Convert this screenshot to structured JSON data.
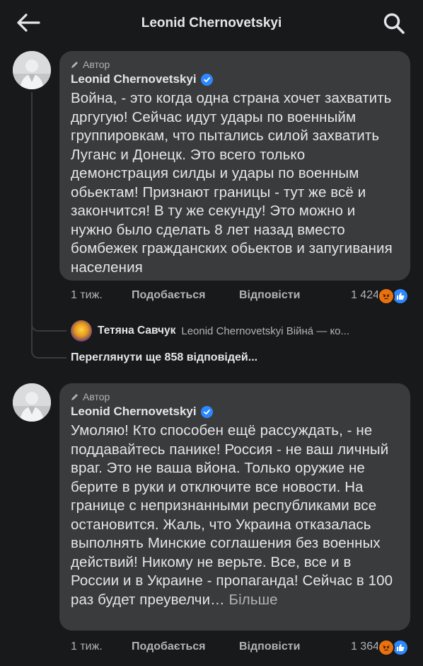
{
  "header": {
    "title": "Leonid Chernovetskyi",
    "back_icon": "arrow-left-icon",
    "search_icon": "search-icon"
  },
  "comments": [
    {
      "badge": "Автор",
      "author": "Leonid Chernovetskyi",
      "verified": true,
      "text": "Война, - это когда одна страна хочет захватить дргугую! Сейчас идут удары по военныйм группировкам, что пытались силой захватить Луганс и Донецк. Это всего только демонстрация силды и удары по военным обьектам!  Признают границы - тут же всё и  закончится! В ту же секунду! Это можно и нужно было сделать 8 лет назад вместо бомбежек гражданских обьектов и запугивания населения",
      "more": "",
      "time": "1 тиж.",
      "like_label": "Подобається",
      "reply_label": "Відповісти",
      "reaction_count": "1 424"
    },
    {
      "badge": "Автор",
      "author": "Leonid Chernovetskyi",
      "verified": true,
      "text": "Умоляю! Кто способен ещё рассуждать, - не поддавайтесь панике! Россия - не ваш личный враг. Это не ваша вйона. Только оружие не берите в руки и отключите все новости. На границе с непризнанными республиками все остановится. Жаль, что Украина отказалась выполнять Минские соглашения без военных действий! Никому не верьте. Все, все и в России и в Украине - пропаганда! Сейчас в 100 раз будет преувелчи…",
      "more": " Більше",
      "time": "1 тиж.",
      "like_label": "Подобається",
      "reply_label": "Відповісти",
      "reaction_count": "1 364"
    }
  ],
  "reply_preview": {
    "name": "Тетяна Савчук",
    "text": "Leonid Chernovetskyi Війна́ — ко..."
  },
  "more_replies": "Переглянути ще 858 відповідей...",
  "colors": {
    "background": "#18191a",
    "bubble": "#3a3b3c",
    "primary_text": "#e4e6eb",
    "secondary_text": "#b0b3b8",
    "verified": "#2d88ff",
    "like": "#2d88ff",
    "angry": "#e9710f"
  },
  "reaction_icons": [
    "angry-reaction-icon",
    "like-reaction-icon"
  ]
}
